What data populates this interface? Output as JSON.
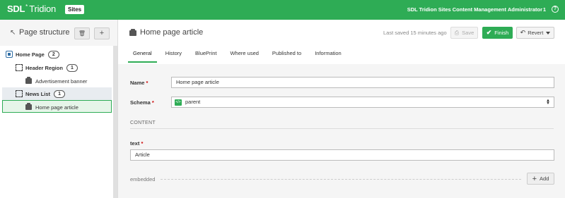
{
  "topbar": {
    "brand_sdl": "SDL",
    "brand_star": "*",
    "brand_product": "Tridion",
    "badge": "Sites",
    "user": "SDL Tridion Sites Content Management Administrator",
    "user_count": "1",
    "help": "?"
  },
  "left_panel": {
    "title_icon": "↖",
    "title": "Page structure",
    "delete_icon": "🗑",
    "add_icon": "+",
    "tree": {
      "home_page": {
        "label": "Home Page",
        "count": "2"
      },
      "header_region": {
        "label": "Header Region",
        "count": "1"
      },
      "advert": {
        "label": "Advertisement banner"
      },
      "news_list": {
        "label": "News List",
        "count": "1"
      },
      "home_article": {
        "label": "Home page article"
      }
    }
  },
  "main": {
    "title": "Home page article",
    "last_saved": "Last saved 15 minutes ago",
    "save_label": "Save",
    "save_icon": "⎙",
    "finish_label": "Finish",
    "finish_icon": "✔",
    "revert_label": "Revert",
    "revert_icon": "↶",
    "tabs": [
      {
        "label": "General"
      },
      {
        "label": "History"
      },
      {
        "label": "BluePrint"
      },
      {
        "label": "Where used"
      },
      {
        "label": "Published to"
      },
      {
        "label": "Information"
      }
    ],
    "form": {
      "name_label": "Name",
      "name_value": "Home page article",
      "schema_label": "Schema",
      "schema_icon": "</>",
      "schema_value": "parent",
      "required": "*",
      "section": "CONTENT",
      "text_label": "text",
      "text_value": "Article",
      "embedded_label": "embedded",
      "add_icon": "+",
      "add_label": "Add"
    }
  },
  "colors": {
    "brand_green": "#2eac55",
    "panel_bg": "#f5f5f5",
    "required_red": "#cc0000"
  }
}
